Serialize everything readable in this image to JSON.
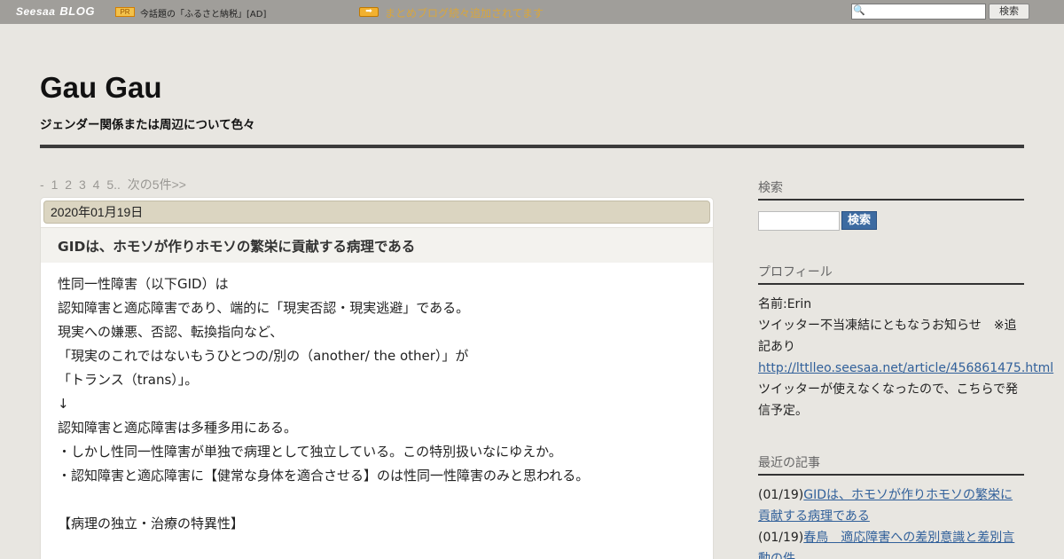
{
  "topbar": {
    "logo_text": "Seesaa",
    "logo_blog": "BLOG",
    "pr_label": "PR",
    "ad_text": "今話題の「ふるさと納税」[AD]",
    "arrow_badge": "➡",
    "notice": "まとめブログ続々追加されてます",
    "search_placeholder": "",
    "search_button": "検索"
  },
  "header": {
    "title": "Gau Gau",
    "subtitle": "ジェンダー関係または周辺について色々"
  },
  "pager": {
    "dash": "-",
    "pages": [
      "1",
      "2",
      "3",
      "4",
      "5.."
    ],
    "next": "次の5件>>"
  },
  "article": {
    "date": "2020年01月19日",
    "title": "GIDは、ホモソが作りホモソの繁栄に貢献する病理である",
    "lines": [
      "性同一性障害（以下GID）は",
      "認知障害と適応障害であり、端的に「現実否認・現実逃避」である。",
      "現実への嫌悪、否認、転換指向など、",
      "「現実のこれではないもうひとつの/別の（another/ the other）」が",
      "「トランス（trans）」。",
      "↓",
      "認知障害と適応障害は多種多用にある。",
      "・しかし性同一性障害が単独で病理として独立している。この特別扱いなにゆえか。",
      "・認知障害と適応障害に【健常な身体を適合させる】のは性同一性障害のみと思われる。",
      "",
      "【病理の独立・治療の特異性】"
    ]
  },
  "sidebar": {
    "search": {
      "heading": "検索",
      "button": "検索"
    },
    "profile": {
      "heading": "プロフィール",
      "name": "名前:Erin",
      "notice": "ツイッター不当凍結にともなうお知らせ　※追記あり",
      "link": "http://lttlleo.seesaa.net/article/456861475.html",
      "note": "ツイッターが使えなくなったので、こちらで発信予定。"
    },
    "recent": {
      "heading": "最近の記事",
      "items": [
        {
          "date": "(01/19)",
          "title": "GIDは、ホモソが作りホモソの繁栄に貢献する病理である"
        },
        {
          "date": "(01/19)",
          "title": "春鳥　適応障害への差別意識と差別言動の件"
        }
      ]
    }
  },
  "colors": {
    "topbar_bg": "#a09e9a",
    "page_bg": "#e8e6e1",
    "date_bar_bg": "#dbd5c1",
    "link": "#31609a",
    "search_button": "#3d6ba1"
  }
}
